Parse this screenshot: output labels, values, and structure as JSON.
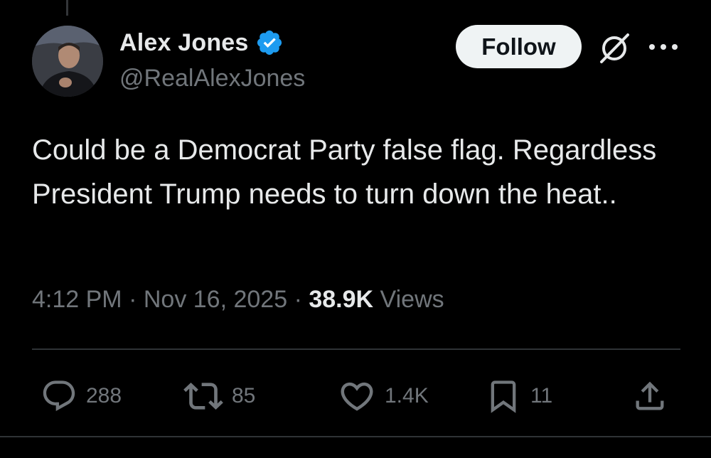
{
  "author": {
    "name": "Alex Jones",
    "handle": "@RealAlexJones",
    "verified": true
  },
  "header": {
    "follow_label": "Follow"
  },
  "tweet": {
    "text": "Could be a Democrat Party false flag. Regardless President Trump needs to turn down the heat.."
  },
  "meta": {
    "time": "4:12 PM",
    "separator": "·",
    "date": "Nov 16, 2025",
    "views_count": "38.9K",
    "views_label": "Views"
  },
  "actions": {
    "replies": "288",
    "reposts": "85",
    "likes": "1.4K",
    "bookmarks": "11"
  },
  "icons": {
    "verified": "verified-badge-icon",
    "grok": "grok-icon",
    "more": "more-icon",
    "reply": "reply-icon",
    "repost": "repost-icon",
    "like": "heart-icon",
    "bookmark": "bookmark-icon",
    "share": "share-icon"
  },
  "colors": {
    "background": "#000000",
    "text": "#e7e9ea",
    "muted": "#71767b",
    "verified_blue": "#1d9bf0",
    "button_bg": "#eff3f4",
    "divider": "#2f3336"
  }
}
